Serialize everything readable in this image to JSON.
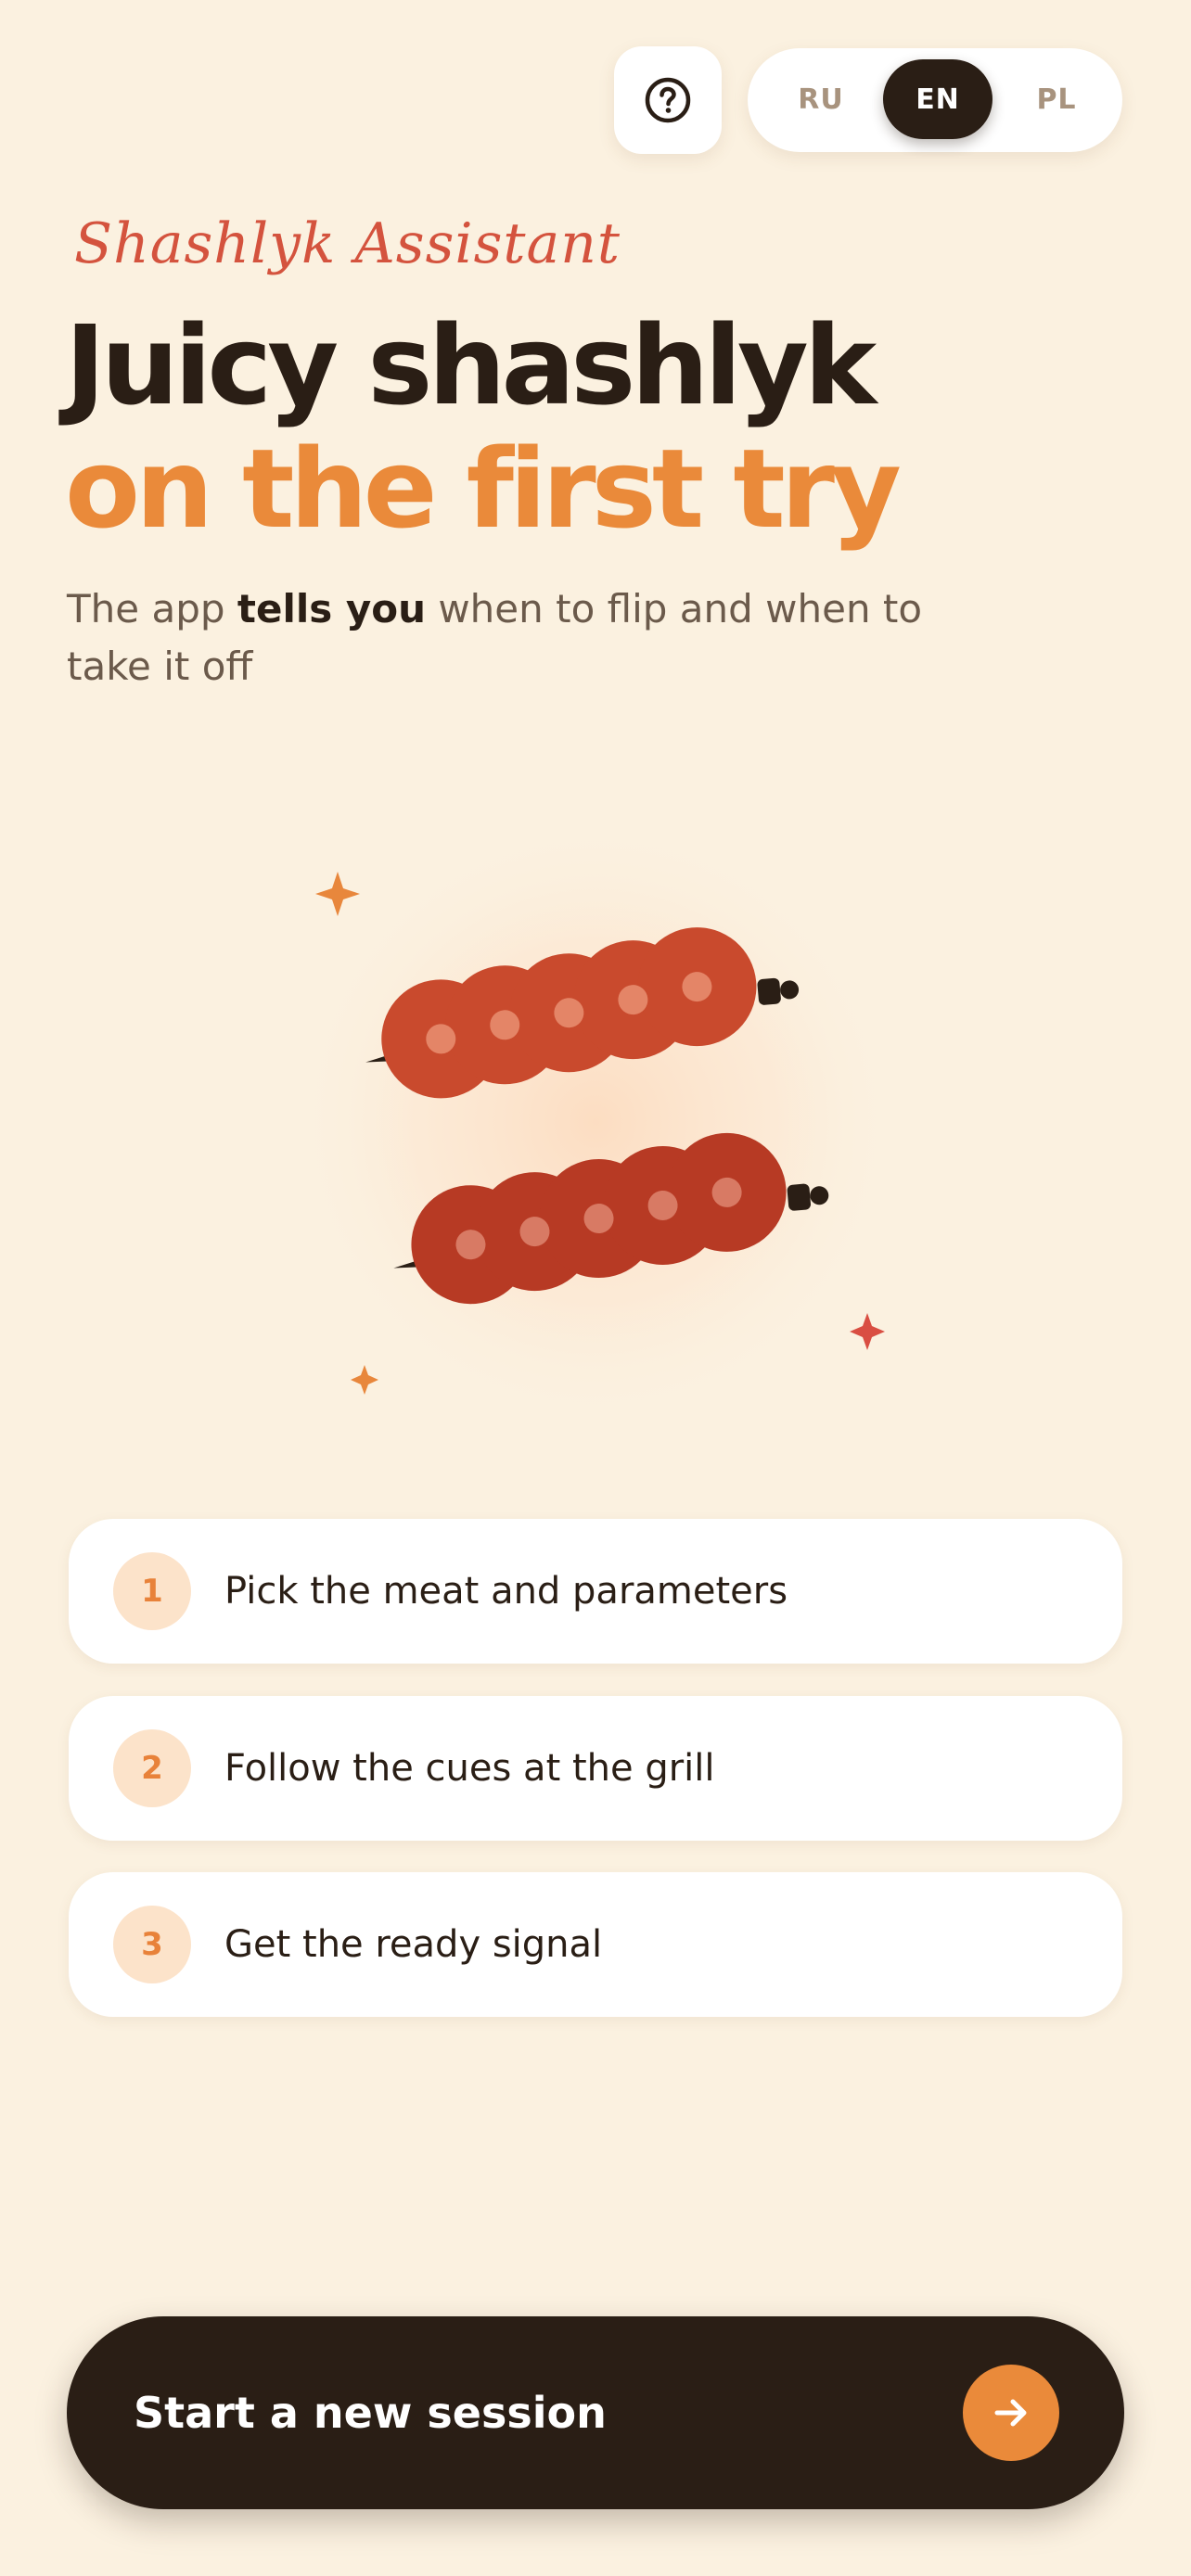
{
  "header": {
    "help_icon": "question-circle-icon",
    "languages": [
      {
        "code": "RU",
        "active": false
      },
      {
        "code": "EN",
        "active": true
      },
      {
        "code": "PL",
        "active": false
      }
    ]
  },
  "hero": {
    "eyebrow": "Shashlyk Assistant",
    "title_line1": "Juicy shashlyk",
    "title_line2": "on the first try",
    "subtitle_prefix": "The app ",
    "subtitle_bold": "tells you",
    "subtitle_suffix": " when to flip and when to take it off"
  },
  "illustration": {
    "icon": "skewers-illustration-icon"
  },
  "steps": [
    {
      "number": "1",
      "text": "Pick the meat and parameters"
    },
    {
      "number": "2",
      "text": "Follow the cues at the grill"
    },
    {
      "number": "3",
      "text": "Get the ready signal"
    }
  ],
  "cta": {
    "label": "Start a new session",
    "icon": "arrow-right-icon"
  },
  "colors": {
    "background": "#FBF1E0",
    "dark": "#2A1E15",
    "accent_orange": "#EA8A3A",
    "accent_red": "#D4533E",
    "step_badge_bg": "#FCE3CA"
  }
}
